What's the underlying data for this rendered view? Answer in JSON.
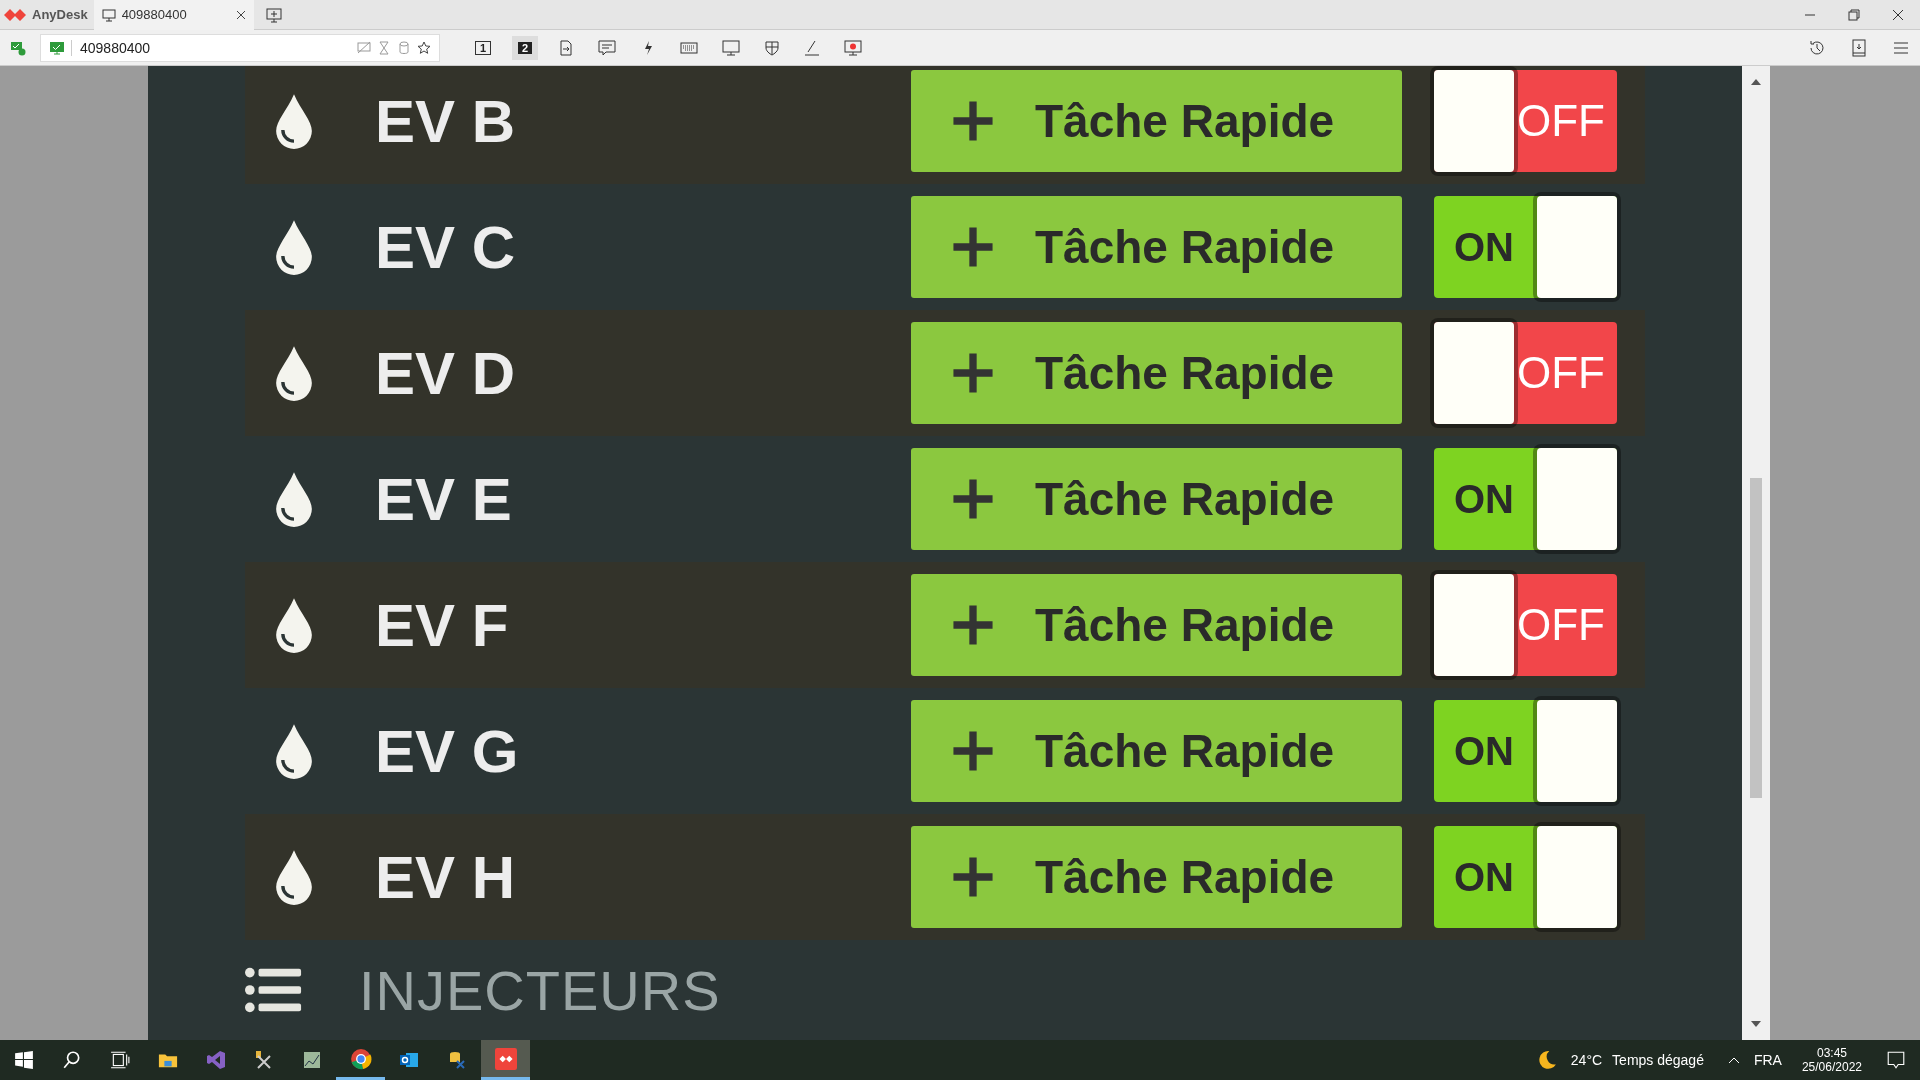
{
  "window": {
    "app_name": "AnyDesk",
    "tab": {
      "label": "409880400",
      "selected": true
    }
  },
  "address_bar": {
    "value": "409880400"
  },
  "monitor_buttons": [
    {
      "label": "1",
      "selected": false
    },
    {
      "label": "2",
      "selected": true
    }
  ],
  "valves": [
    {
      "name": "EV B",
      "action": "Tâche Rapide",
      "on": false,
      "state_label": "OFF"
    },
    {
      "name": "EV C",
      "action": "Tâche Rapide",
      "on": true,
      "state_label": "ON"
    },
    {
      "name": "EV D",
      "action": "Tâche Rapide",
      "on": false,
      "state_label": "OFF"
    },
    {
      "name": "EV E",
      "action": "Tâche Rapide",
      "on": true,
      "state_label": "ON"
    },
    {
      "name": "EV F",
      "action": "Tâche Rapide",
      "on": false,
      "state_label": "OFF"
    },
    {
      "name": "EV G",
      "action": "Tâche Rapide",
      "on": true,
      "state_label": "ON"
    },
    {
      "name": "EV H",
      "action": "Tâche Rapide",
      "on": true,
      "state_label": "ON"
    }
  ],
  "section_heading": "INJECTEURS",
  "taskbar": {
    "weather": "24°C",
    "weather_text": "Temps dégagé",
    "language": "FRA",
    "time": "03:45",
    "date": "25/06/2022"
  }
}
